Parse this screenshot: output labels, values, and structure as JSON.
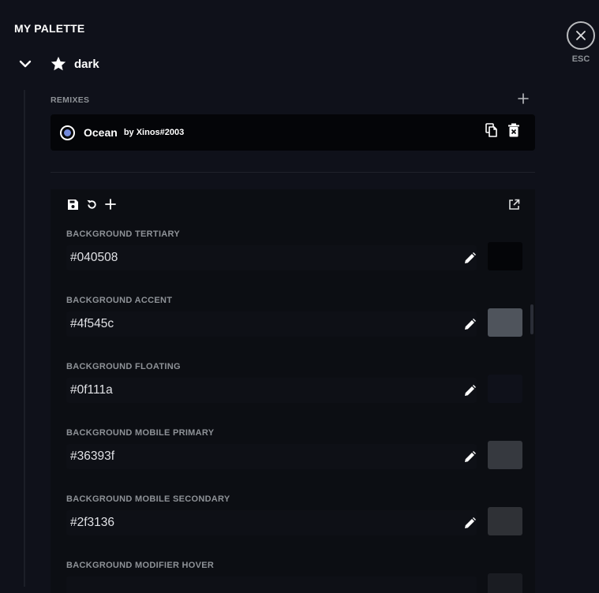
{
  "header": {
    "title": "MY PALETTE",
    "close_label": "ESC"
  },
  "theme": {
    "name": "dark",
    "icon": "star-icon",
    "expanded": true
  },
  "remixes": {
    "section_label": "REMIXES",
    "items": [
      {
        "name": "Ocean",
        "author": "by Xinos#2003",
        "selected": true
      }
    ]
  },
  "editor": {
    "colors": [
      {
        "label": "BACKGROUND TERTIARY",
        "value": "#040508",
        "swatch": "#040508"
      },
      {
        "label": "BACKGROUND ACCENT",
        "value": "#4f545c",
        "swatch": "#4f545c"
      },
      {
        "label": "BACKGROUND FLOATING",
        "value": "#0f111a",
        "swatch": "#0f111a"
      },
      {
        "label": "BACKGROUND MOBILE PRIMARY",
        "value": "#36393f",
        "swatch": "#36393f"
      },
      {
        "label": "BACKGROUND MOBILE SECONDARY",
        "value": "#2f3136",
        "swatch": "#2f3136"
      },
      {
        "label": "BACKGROUND MODIFIER HOVER",
        "value": "",
        "swatch": "#1a1c22"
      }
    ]
  },
  "colors": {
    "background": "#0f111a",
    "accent": "#7289da",
    "text_muted": "#8e9297"
  }
}
